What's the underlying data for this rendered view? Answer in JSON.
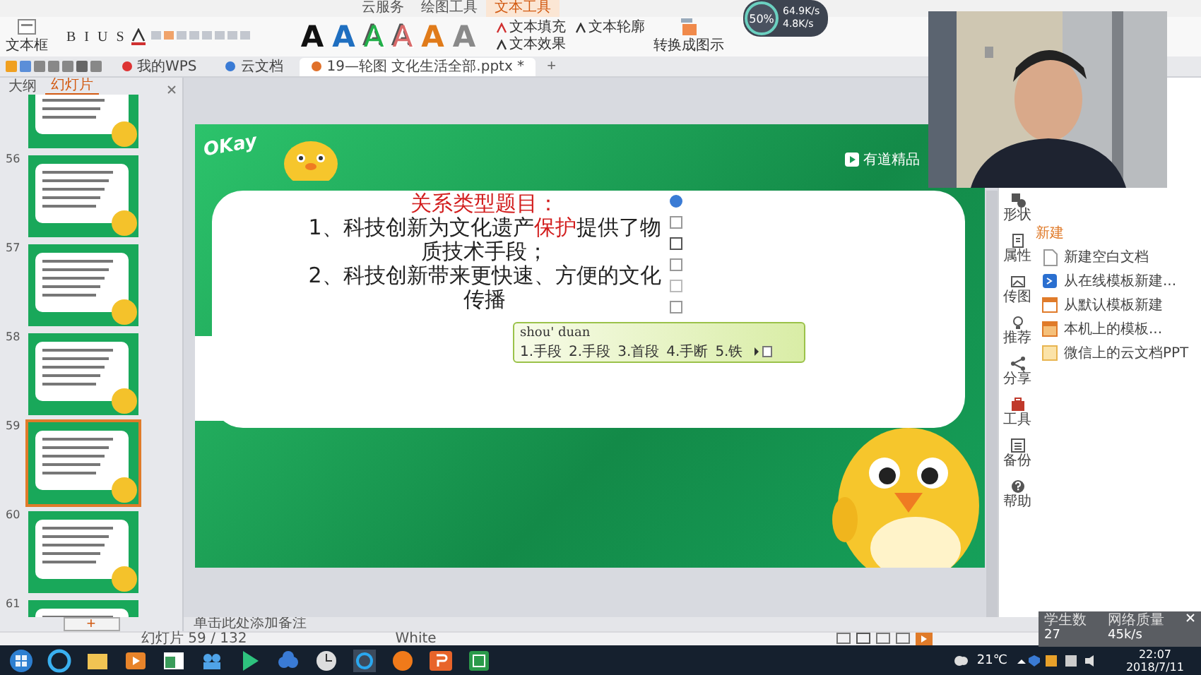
{
  "ribbon": {
    "tabs": [
      {
        "label": "云服务",
        "selected": false
      },
      {
        "label": "绘图工具",
        "selected": false
      },
      {
        "label": "文本工具",
        "selected": true
      }
    ],
    "text_box": "文本框",
    "format_buttons": [
      "B",
      "I",
      "U",
      "S"
    ],
    "style_samples": [
      {
        "label": "A",
        "color": "#111111",
        "kind": "solid"
      },
      {
        "label": "A",
        "color": "#1f6fc0",
        "kind": "solid"
      },
      {
        "label": "A",
        "color": "#22b04a",
        "kind": "outline"
      },
      {
        "label": "A",
        "color": "#d96b6b",
        "kind": "outline"
      },
      {
        "label": "A",
        "color": "#e07b1a",
        "kind": "solid"
      },
      {
        "label": "A",
        "color": "#8a8a8a",
        "kind": "solid"
      }
    ],
    "text_tools": [
      "文本填充",
      "文本轮廓",
      "文本效果"
    ],
    "convert": "转换成图示"
  },
  "doc_tabs": [
    {
      "label": "我的WPS",
      "selected": false
    },
    {
      "label": "云文档",
      "selected": false
    },
    {
      "label": "19—轮图 文化生活全部.pptx *",
      "selected": true
    }
  ],
  "new_tab": "+",
  "net_meter": {
    "percent": "50%",
    "upload": "64.9K/s",
    "download": "4.8K/s"
  },
  "outline_tabs": [
    {
      "label": "大纲",
      "selected": false
    },
    {
      "label": "幻灯片",
      "selected": true
    }
  ],
  "thumbnails": [
    {
      "selected": false
    },
    {
      "number": "56",
      "selected": false
    },
    {
      "number": "57",
      "selected": false
    },
    {
      "number": "58",
      "selected": false
    },
    {
      "number": "59",
      "selected": true
    },
    {
      "number": "60",
      "selected": false
    },
    {
      "number": "61",
      "selected": false
    }
  ],
  "add_slide": "+",
  "slide": {
    "logo": "OKay",
    "brand": "有道精品",
    "title": "关系类型题目：",
    "lines": [
      "1、科技创新为文化遗产**保护**提供了物质技术手段；",
      "2、科技创新带来更快速、方便的文化传播"
    ]
  },
  "ime": {
    "pinyin": "shou' duan",
    "candidates": [
      "1.手段",
      "2.手段",
      "3.首段",
      "4.手断",
      "5.铁"
    ]
  },
  "task_pane": {
    "tools": [
      "形状",
      "属性",
      "传图",
      "推荐",
      "分享",
      "工具",
      "备份",
      "帮助"
    ],
    "section": "新建",
    "items": [
      "新建空白文档",
      "从在线模板新建...",
      "从默认模板新建",
      "本机上的模板...",
      "微信上的云文档PPT"
    ]
  },
  "notes": "单击此处添加备注",
  "status": {
    "slide_count": "幻灯片 59 / 132",
    "theme": "White"
  },
  "classroom": {
    "students_label": "学生数",
    "students": "27",
    "network_label": "网络质量",
    "network": "45k/s"
  },
  "taskbar": {
    "weather": "21℃",
    "time": "22:07",
    "date": "2018/7/11"
  }
}
